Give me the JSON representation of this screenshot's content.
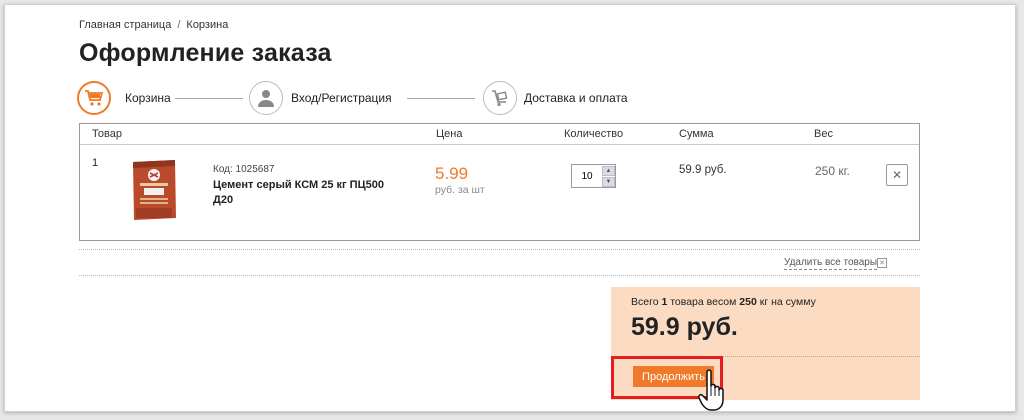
{
  "breadcrumb": {
    "home": "Главная страница",
    "separator": "/",
    "current": "Корзина"
  },
  "page_title": "Оформление заказа",
  "steps": [
    {
      "label": "Корзина",
      "icon": "cart-icon",
      "active": true
    },
    {
      "label": "Вход/Регистрация",
      "icon": "user-icon",
      "active": false
    },
    {
      "label": "Доставка и оплата",
      "icon": "delivery-icon",
      "active": false
    }
  ],
  "table": {
    "headers": {
      "item": "Товар",
      "price": "Цена",
      "quantity": "Количество",
      "sum": "Сумма",
      "weight": "Вес"
    },
    "rows": [
      {
        "number": "1",
        "code": "Код: 1025687",
        "name": "Цемент серый КСМ 25 кг ПЦ500 Д20",
        "price": "5.99",
        "price_unit": "руб. за шт",
        "quantity": "10",
        "sum": "59.9 руб.",
        "weight": "250 кг."
      }
    ]
  },
  "remove_all": "Удалить все товары",
  "summary": {
    "prefix": "Всего ",
    "items_count": "1",
    "middle": " товара весом ",
    "weight": "250",
    "suffix": " кг на сумму",
    "total": "59.9 руб."
  },
  "continue_label": "Продолжить",
  "colors": {
    "accent": "#f07a2a",
    "summary_bg": "#fbdcc3",
    "highlight": "#e51d1d"
  }
}
